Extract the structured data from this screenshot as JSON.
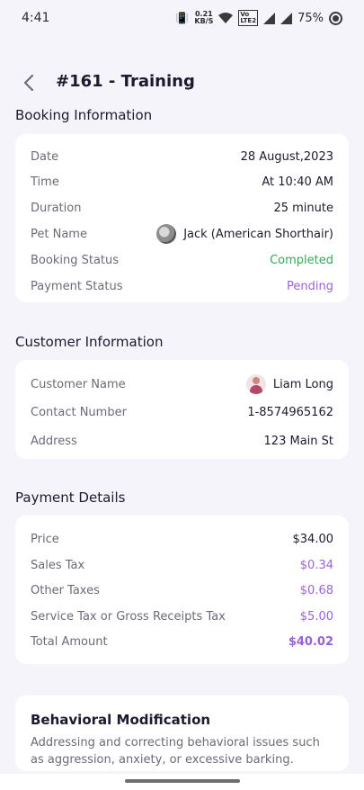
{
  "status_bar": {
    "time": "4:41",
    "net_speed": "0.21\nKB/S",
    "volte": "VoLTE\nLTE2",
    "battery": "75%"
  },
  "header": {
    "back_icon": "chevron-left-icon",
    "title": "#161 - Training"
  },
  "booking": {
    "section_title": "Booking Information",
    "rows": [
      {
        "label": "Date",
        "value": "28 August,2023"
      },
      {
        "label": "Time",
        "value": "At 10:40 AM"
      },
      {
        "label": "Duration",
        "value": "25 minute"
      },
      {
        "label": "Pet Name",
        "value": "Jack (American Shorthair)"
      },
      {
        "label": "Booking Status",
        "value": "Completed"
      },
      {
        "label": "Payment Status",
        "value": "Pending"
      }
    ]
  },
  "customer": {
    "section_title": "Customer Information",
    "rows": [
      {
        "label": "Customer Name",
        "value": "Liam Long"
      },
      {
        "label": "Contact Number",
        "value": "1-8574965162"
      },
      {
        "label": "Address",
        "value": "123 Main St"
      }
    ]
  },
  "payment": {
    "section_title": "Payment Details",
    "rows": [
      {
        "label": "Price",
        "value": "$34.00"
      },
      {
        "label": "Sales Tax",
        "value": "$0.34"
      },
      {
        "label": "Other Taxes",
        "value": "$0.68"
      },
      {
        "label": "Service Tax or Gross Receipts Tax",
        "value": "$5.00"
      },
      {
        "label": "Total Amount",
        "value": "$40.02"
      }
    ]
  },
  "service": {
    "title": "Behavioral Modification",
    "description": "Addressing and correcting behavioral issues such as aggression, anxiety, or excessive barking."
  },
  "colors": {
    "background": "#f6f4fb",
    "card": "#ffffff",
    "status_completed": "#3aa75a",
    "status_pending": "#9a62d9"
  }
}
